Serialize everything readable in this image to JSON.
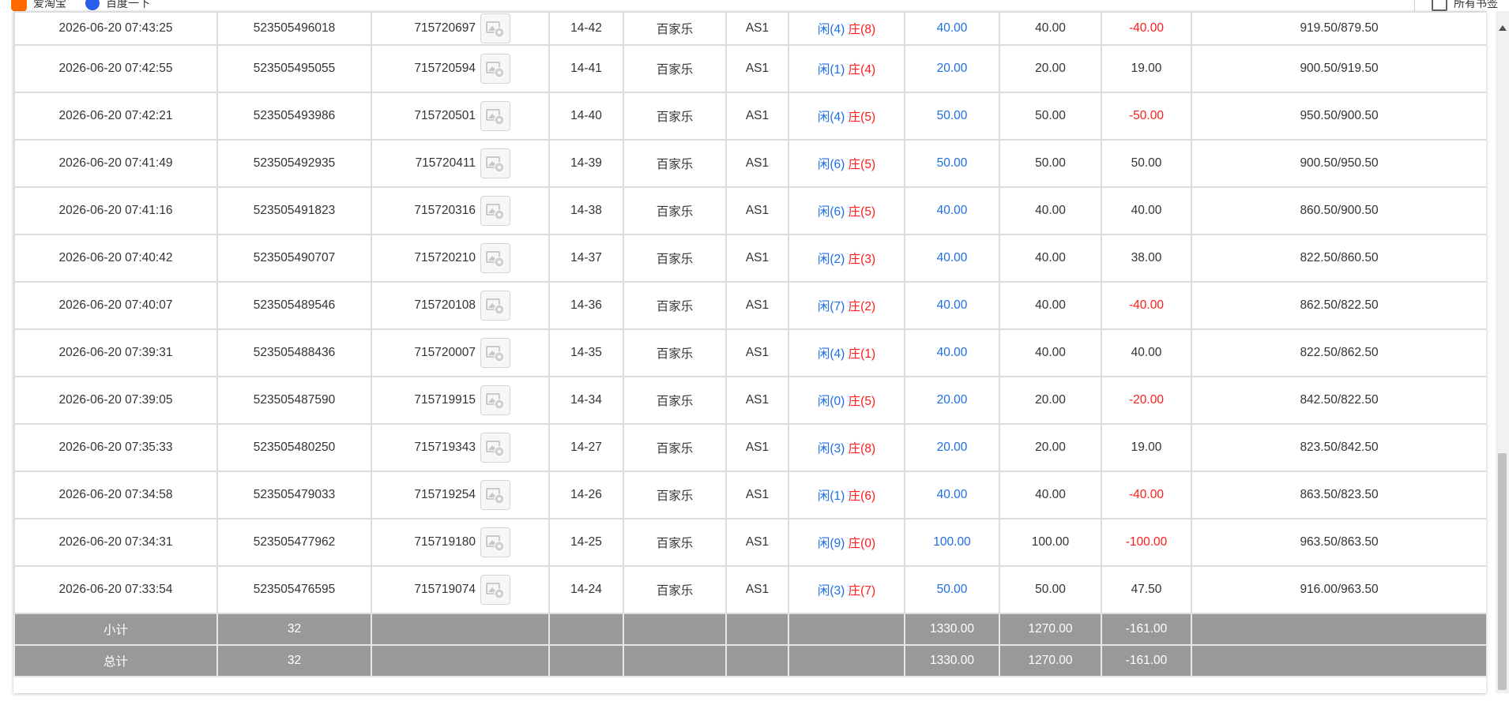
{
  "bookmarks": {
    "item1_label": "爱淘宝",
    "item2_label": "百度一下",
    "all_bookmarks_label": "所有书签"
  },
  "rows": [
    {
      "time": "2026-06-20 07:43:25",
      "order": "523505496018",
      "game_id": "715720697",
      "shoe": "14-42",
      "game": "百家乐",
      "table": "AS1",
      "player": "闲(4)",
      "banker": "庄(8)",
      "bet": "40.00",
      "valid": "40.00",
      "win": "-40.00",
      "balance": "919.50/879.50",
      "win_neg": true
    },
    {
      "time": "2026-06-20 07:42:55",
      "order": "523505495055",
      "game_id": "715720594",
      "shoe": "14-41",
      "game": "百家乐",
      "table": "AS1",
      "player": "闲(1)",
      "banker": "庄(4)",
      "bet": "20.00",
      "valid": "20.00",
      "win": "19.00",
      "balance": "900.50/919.50",
      "win_neg": false
    },
    {
      "time": "2026-06-20 07:42:21",
      "order": "523505493986",
      "game_id": "715720501",
      "shoe": "14-40",
      "game": "百家乐",
      "table": "AS1",
      "player": "闲(4)",
      "banker": "庄(5)",
      "bet": "50.00",
      "valid": "50.00",
      "win": "-50.00",
      "balance": "950.50/900.50",
      "win_neg": true
    },
    {
      "time": "2026-06-20 07:41:49",
      "order": "523505492935",
      "game_id": "715720411",
      "shoe": "14-39",
      "game": "百家乐",
      "table": "AS1",
      "player": "闲(6)",
      "banker": "庄(5)",
      "bet": "50.00",
      "valid": "50.00",
      "win": "50.00",
      "balance": "900.50/950.50",
      "win_neg": false
    },
    {
      "time": "2026-06-20 07:41:16",
      "order": "523505491823",
      "game_id": "715720316",
      "shoe": "14-38",
      "game": "百家乐",
      "table": "AS1",
      "player": "闲(6)",
      "banker": "庄(5)",
      "bet": "40.00",
      "valid": "40.00",
      "win": "40.00",
      "balance": "860.50/900.50",
      "win_neg": false
    },
    {
      "time": "2026-06-20 07:40:42",
      "order": "523505490707",
      "game_id": "715720210",
      "shoe": "14-37",
      "game": "百家乐",
      "table": "AS1",
      "player": "闲(2)",
      "banker": "庄(3)",
      "bet": "40.00",
      "valid": "40.00",
      "win": "38.00",
      "balance": "822.50/860.50",
      "win_neg": false
    },
    {
      "time": "2026-06-20 07:40:07",
      "order": "523505489546",
      "game_id": "715720108",
      "shoe": "14-36",
      "game": "百家乐",
      "table": "AS1",
      "player": "闲(7)",
      "banker": "庄(2)",
      "bet": "40.00",
      "valid": "40.00",
      "win": "-40.00",
      "balance": "862.50/822.50",
      "win_neg": true
    },
    {
      "time": "2026-06-20 07:39:31",
      "order": "523505488436",
      "game_id": "715720007",
      "shoe": "14-35",
      "game": "百家乐",
      "table": "AS1",
      "player": "闲(4)",
      "banker": "庄(1)",
      "bet": "40.00",
      "valid": "40.00",
      "win": "40.00",
      "balance": "822.50/862.50",
      "win_neg": false
    },
    {
      "time": "2026-06-20 07:39:05",
      "order": "523505487590",
      "game_id": "715719915",
      "shoe": "14-34",
      "game": "百家乐",
      "table": "AS1",
      "player": "闲(0)",
      "banker": "庄(5)",
      "bet": "20.00",
      "valid": "20.00",
      "win": "-20.00",
      "balance": "842.50/822.50",
      "win_neg": true
    },
    {
      "time": "2026-06-20 07:35:33",
      "order": "523505480250",
      "game_id": "715719343",
      "shoe": "14-27",
      "game": "百家乐",
      "table": "AS1",
      "player": "闲(3)",
      "banker": "庄(8)",
      "bet": "20.00",
      "valid": "20.00",
      "win": "19.00",
      "balance": "823.50/842.50",
      "win_neg": false
    },
    {
      "time": "2026-06-20 07:34:58",
      "order": "523505479033",
      "game_id": "715719254",
      "shoe": "14-26",
      "game": "百家乐",
      "table": "AS1",
      "player": "闲(1)",
      "banker": "庄(6)",
      "bet": "40.00",
      "valid": "40.00",
      "win": "-40.00",
      "balance": "863.50/823.50",
      "win_neg": true
    },
    {
      "time": "2026-06-20 07:34:31",
      "order": "523505477962",
      "game_id": "715719180",
      "shoe": "14-25",
      "game": "百家乐",
      "table": "AS1",
      "player": "闲(9)",
      "banker": "庄(0)",
      "bet": "100.00",
      "valid": "100.00",
      "win": "-100.00",
      "balance": "963.50/863.50",
      "win_neg": true
    },
    {
      "time": "2026-06-20 07:33:54",
      "order": "523505476595",
      "game_id": "715719074",
      "shoe": "14-24",
      "game": "百家乐",
      "table": "AS1",
      "player": "闲(3)",
      "banker": "庄(7)",
      "bet": "50.00",
      "valid": "50.00",
      "win": "47.50",
      "balance": "916.00/963.50",
      "win_neg": false
    }
  ],
  "subtotal": {
    "label": "小计",
    "count": "32",
    "bet": "1330.00",
    "valid": "1270.00",
    "win": "-161.00"
  },
  "total": {
    "label": "总计",
    "count": "32",
    "bet": "1330.00",
    "valid": "1270.00",
    "win": "-161.00"
  },
  "colors": {
    "blue": "#1e6ee6",
    "red": "#ff1a1a",
    "summary_bg": "#999999"
  },
  "icons": {
    "thumbnail": "video-replay-icon"
  }
}
